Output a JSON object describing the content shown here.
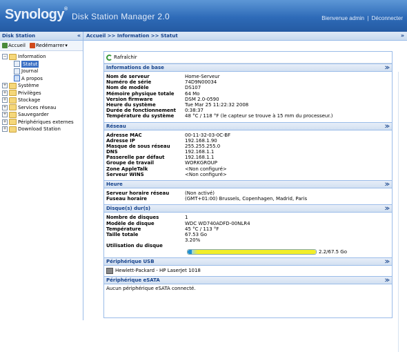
{
  "header": {
    "logo": "Synology",
    "title": "Disk Station Manager 2.0",
    "welcome": "Bienvenue admin",
    "separator": "|",
    "logout": "Déconnecter"
  },
  "left": {
    "title": "Disk Station",
    "collapse": "«",
    "toolbar": {
      "home": "Accueil",
      "restart": "Redémarrer"
    },
    "tree": [
      {
        "label": "Information",
        "expanded": true
      },
      {
        "label": "Statut",
        "selected": true
      },
      {
        "label": "Journal"
      },
      {
        "label": "A propos"
      },
      {
        "label": "Système"
      },
      {
        "label": "Privilèges"
      },
      {
        "label": "Stockage"
      },
      {
        "label": "Services réseau"
      },
      {
        "label": "Sauvegarder"
      },
      {
        "label": "Périphériques externes"
      },
      {
        "label": "Download Station"
      }
    ]
  },
  "main": {
    "breadcrumb": "Accueil >> Information >> Statut",
    "collapse": "»",
    "refresh": "Rafraîchir",
    "sections": {
      "basic": {
        "title": "Informations de base",
        "rows": [
          {
            "k": "Nom de serveur",
            "v": "Home-Serveur"
          },
          {
            "k": "Numéro de série",
            "v": "74D9N00034"
          },
          {
            "k": "Nom de modèle",
            "v": "DS107"
          },
          {
            "k": "Mémoire physique totale",
            "v": "64 Mo"
          },
          {
            "k": "Version firmware",
            "v": "DSM 2.0-0590"
          },
          {
            "k": "Heure du système",
            "v": "Tue Mar 25 11:22:32 2008"
          },
          {
            "k": "Durée de fonctionnement",
            "v": "0:38:37"
          },
          {
            "k": "Température du système",
            "v": "48 °C / 118 °F   (le capteur se trouve à 15 mm du processeur.)"
          }
        ]
      },
      "network": {
        "title": "Réseau",
        "rows": [
          {
            "k": "Adresse MAC",
            "v": "00-11-32-03-0C-BF"
          },
          {
            "k": "Adresse IP",
            "v": "192.168.1.90"
          },
          {
            "k": "Masque de sous réseau",
            "v": "255.255.255.0"
          },
          {
            "k": "DNS",
            "v": "192.168.1.1"
          },
          {
            "k": "Passerelle par défaut",
            "v": "192.168.1.1"
          },
          {
            "k": "Groupe de travail",
            "v": "WORKGROUP"
          },
          {
            "k": "Zone AppleTalk",
            "v": "<Non configuré>"
          },
          {
            "k": "Serveur WINS",
            "v": "<Non configuré>"
          }
        ]
      },
      "time": {
        "title": "Heure",
        "rows": [
          {
            "k": "Serveur horaire réseau",
            "v": "(Non activé)"
          },
          {
            "k": "Fuseau horaire",
            "v": "(GMT+01:00) Brussels, Copenhagen, Madrid, Paris"
          }
        ]
      },
      "disks": {
        "title": "Disque(s) dur(s)",
        "rows": [
          {
            "k": "Nombre de disques",
            "v": "1"
          },
          {
            "k": "Modèle de disque",
            "v": "WDC WD740ADFD-00NLR4"
          },
          {
            "k": "Température",
            "v": "45 °C / 113 °F"
          },
          {
            "k": "Taille totale",
            "v": "67.53 Go"
          }
        ],
        "usage_label": "Utilisation du disque",
        "usage_percent": "3.20%",
        "usage_fraction": 0.032,
        "usage_text": "2.2/67.5 Go"
      },
      "usb": {
        "title": "Périphérique USB",
        "device": "Hewlett-Packard - HP LaserJet 1018"
      },
      "esata": {
        "title": "Périphérique eSATA",
        "text": "Aucun périphérique eSATA connecté."
      }
    }
  }
}
